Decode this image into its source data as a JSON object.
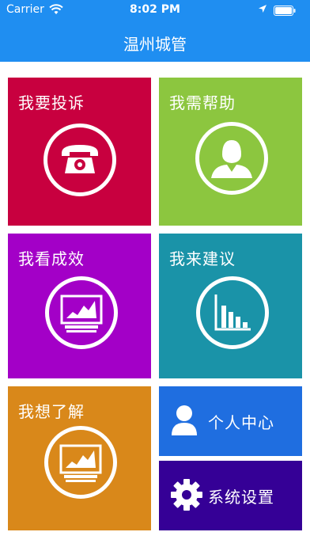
{
  "status_bar": {
    "carrier": "Carrier",
    "time": "8:02 PM",
    "wifi_icon": "wifi-icon",
    "location_icon": "location-arrow-icon",
    "battery_icon": "battery-icon"
  },
  "nav": {
    "title": "温州城管"
  },
  "tiles": {
    "complaint": {
      "label": "我要投诉",
      "icon": "telephone-icon",
      "color": "#c8003f"
    },
    "help": {
      "label": "我需帮助",
      "icon": "person-icon",
      "color": "#8cc63f"
    },
    "results": {
      "label": "我看成效",
      "icon": "monitor-chart-icon",
      "color": "#a300c7"
    },
    "suggest": {
      "label": "我来建议",
      "icon": "bar-chart-icon",
      "color": "#1a93a8"
    },
    "learn": {
      "label": "我想了解",
      "icon": "monitor-chart-icon",
      "color": "#d9881a"
    },
    "personal": {
      "label": "个人中心",
      "icon": "user-icon",
      "color": "#1f6ee0"
    },
    "settings": {
      "label": "系统设置",
      "icon": "gear-icon",
      "color": "#350096"
    }
  }
}
